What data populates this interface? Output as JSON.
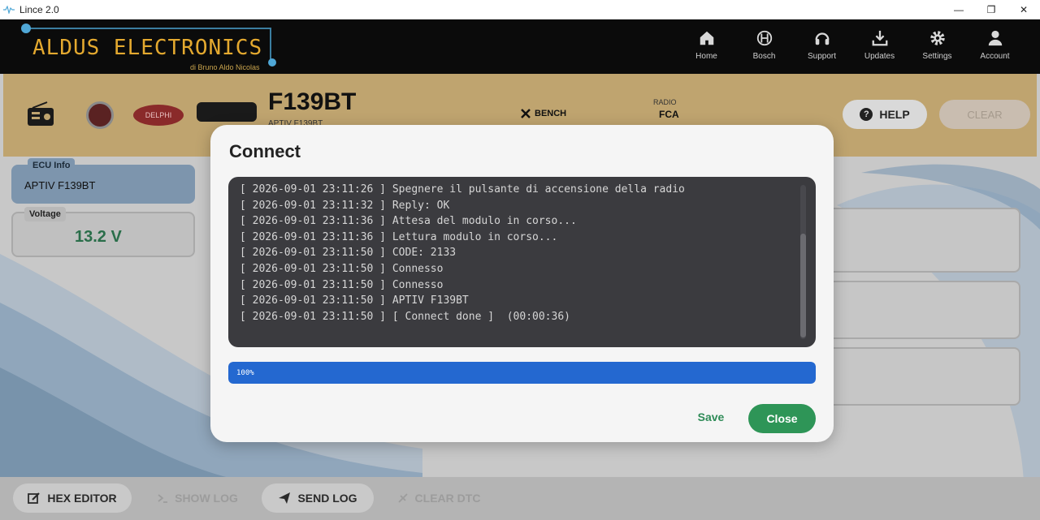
{
  "window": {
    "title": "Lince 2.0",
    "minimize": "—",
    "restore": "❐",
    "close": "✕"
  },
  "header": {
    "brand": "ALDUS ELECTRONICS",
    "brand_sub": "di Bruno Aldo Nicolas",
    "nav": [
      {
        "label": "Home",
        "icon": "home-icon"
      },
      {
        "label": "Bosch",
        "icon": "bosch-icon"
      },
      {
        "label": "Support",
        "icon": "headset-icon"
      },
      {
        "label": "Updates",
        "icon": "download-icon"
      },
      {
        "label": "Settings",
        "icon": "gear-icon"
      },
      {
        "label": "Account",
        "icon": "user-icon"
      }
    ]
  },
  "ecu_bar": {
    "model": "F139BT",
    "model_sub": "APTIV F139BT",
    "delphi": "DELPHI",
    "bench": "BENCH",
    "radio_label": "RADIO",
    "make": "FCA",
    "help_label": "HELP",
    "clear_label": "CLEAR"
  },
  "ecu_info": {
    "tag": "ECU Info",
    "value": "APTIV F139BT"
  },
  "voltage": {
    "tag": "Voltage",
    "value": "13.2 V"
  },
  "bottom_bar": {
    "hex_editor": "HEX EDITOR",
    "show_log": "SHOW LOG",
    "send_log": "SEND LOG",
    "clear_dtc": "CLEAR DTC"
  },
  "modal": {
    "title": "Connect",
    "log": [
      "[ 2026-09-01 23:11:26 ] Spegnere il pulsante di accensione della radio",
      "[ 2026-09-01 23:11:32 ] Reply: OK",
      "[ 2026-09-01 23:11:36 ] Attesa del modulo in corso...",
      "[ 2026-09-01 23:11:36 ] Lettura modulo in corso...",
      "[ 2026-09-01 23:11:50 ] CODE: 2133",
      "[ 2026-09-01 23:11:50 ] Connesso",
      "[ 2026-09-01 23:11:50 ] Connesso",
      "[ 2026-09-01 23:11:50 ] APTIV F139BT",
      "[ 2026-09-01 23:11:50 ] [ Connect done ]  (00:00:36)"
    ],
    "progress_value": 100,
    "progress_label": "100%",
    "save_label": "Save",
    "close_label": "Close"
  },
  "colors": {
    "header_bg": "#0b0b0b",
    "brand": "#e4a92f",
    "progress": "#2468d0",
    "close_button": "#2e9557",
    "save_text": "#2e8b57"
  }
}
